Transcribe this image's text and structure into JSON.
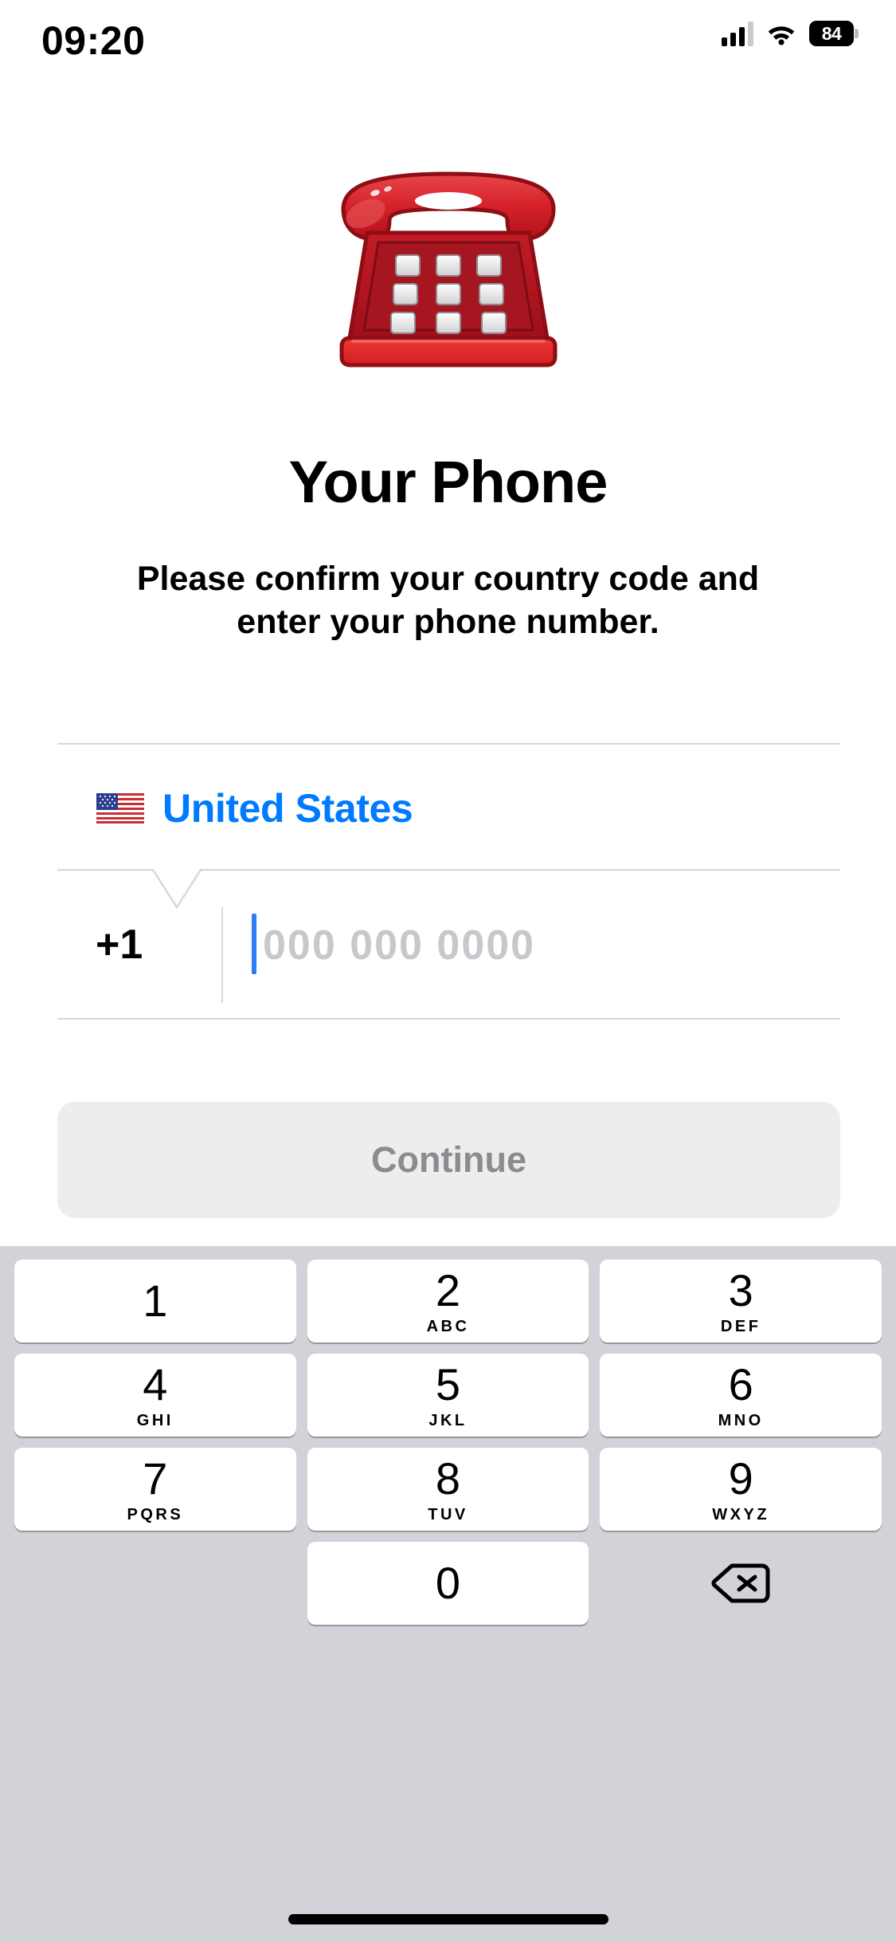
{
  "status_bar": {
    "time": "09:20",
    "battery_level": "84",
    "signal_icon": "cellular-bars-icon",
    "wifi_icon": "wifi-icon",
    "battery_icon": "battery-icon"
  },
  "hero": {
    "emoji_name": "telephone-emoji",
    "emoji_char": "☎️"
  },
  "content": {
    "title": "Your Phone",
    "subtitle": "Please confirm your country code and enter your phone number."
  },
  "country_selector": {
    "flag_name": "flag-united-states-icon",
    "country_name": "United States",
    "accent_color": "#007AFF",
    "chevron_icon": "chevron-down-icon"
  },
  "phone_input": {
    "dial_code": "+1",
    "placeholder": "000 000 0000",
    "value": "",
    "caret_color": "#2d7cf6",
    "placeholder_color": "#c7c7cc"
  },
  "actions": {
    "continue_label": "Continue",
    "continue_enabled": false,
    "continue_bg": "#ededed",
    "continue_text_color": "#8b8b90"
  },
  "keypad": {
    "background": "#d1d3d9",
    "keys": [
      {
        "digit": "1",
        "letters": ""
      },
      {
        "digit": "2",
        "letters": "ABC"
      },
      {
        "digit": "3",
        "letters": "DEF"
      },
      {
        "digit": "4",
        "letters": "GHI"
      },
      {
        "digit": "5",
        "letters": "JKL"
      },
      {
        "digit": "6",
        "letters": "MNO"
      },
      {
        "digit": "7",
        "letters": "PQRS"
      },
      {
        "digit": "8",
        "letters": "TUV"
      },
      {
        "digit": "9",
        "letters": "WXYZ"
      },
      {
        "digit": "0",
        "letters": ""
      }
    ],
    "delete_icon": "backspace-delete-icon"
  },
  "home_indicator": {
    "name": "home-indicator"
  }
}
